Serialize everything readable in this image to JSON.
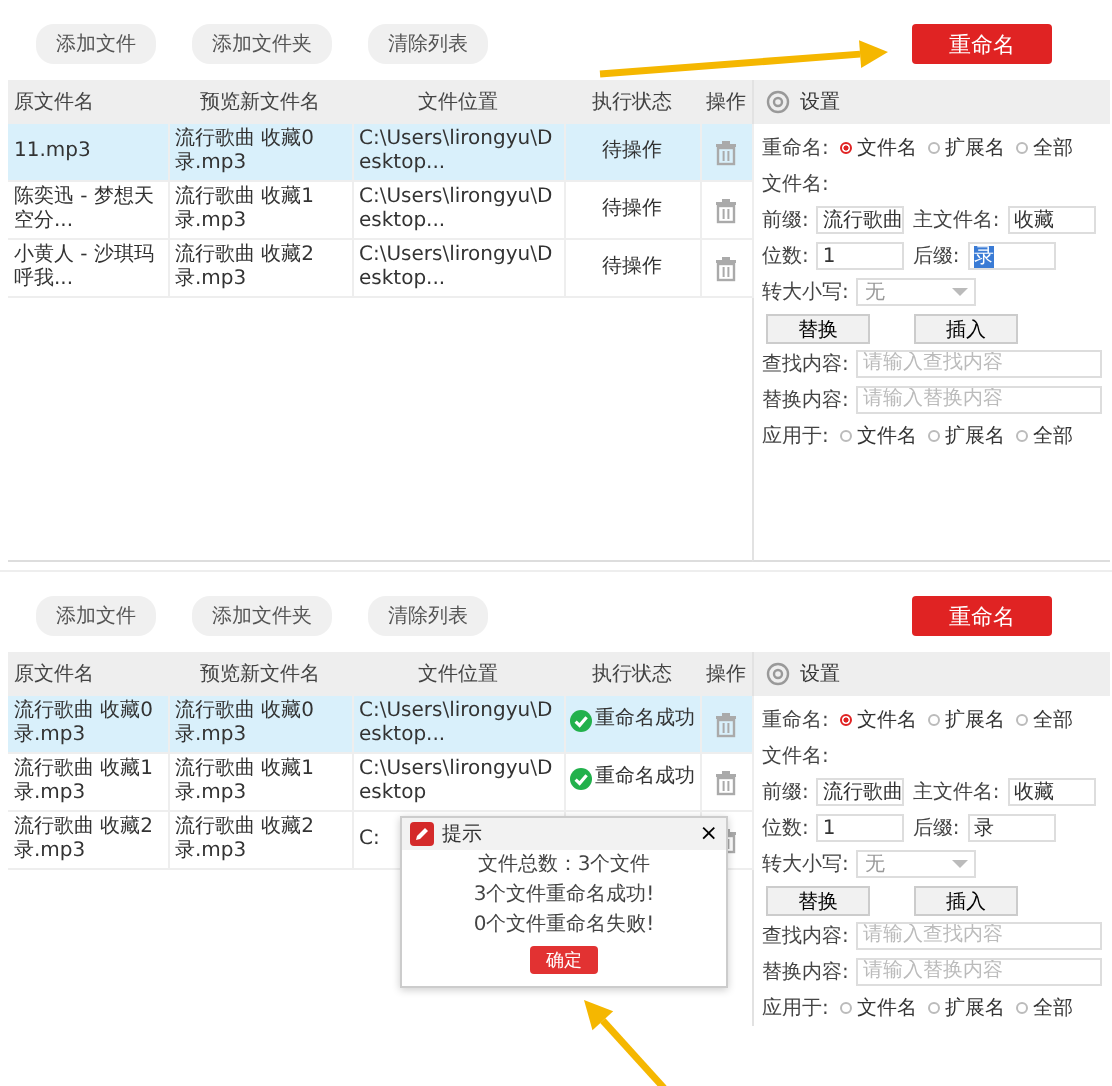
{
  "panels": [
    {
      "arrow": {
        "kind": "rename"
      },
      "toolbar": {
        "buttons": [
          "添加文件",
          "添加文件夹",
          "清除列表"
        ],
        "rename_button": "重命名"
      },
      "table": {
        "columns": [
          "原文件名",
          "预览新文件名",
          "文件位置",
          "执行状态",
          "操作"
        ],
        "rows": [
          {
            "selected": true,
            "original": "11.mp3",
            "preview": "流行歌曲 收藏0录.mp3",
            "location": "C:\\Users\\lirongyu\\Desktop...",
            "status": "待操作",
            "kind": "pending"
          },
          {
            "selected": false,
            "original": "陈奕迅 - 梦想天空分...",
            "preview": "流行歌曲 收藏1录.mp3",
            "location": "C:\\Users\\lirongyu\\Desktop...",
            "status": "待操作",
            "kind": "pending"
          },
          {
            "selected": false,
            "original": "小黄人 - 沙琪玛呼我...",
            "preview": "流行歌曲 收藏2录.mp3",
            "location": "C:\\Users\\lirongyu\\Desktop...",
            "status": "待操作",
            "kind": "pending"
          }
        ]
      },
      "settings": {
        "title": "设置",
        "rename_label": "重命名:",
        "rename_options": [
          {
            "label": "文件名",
            "selected": true
          },
          {
            "label": "扩展名",
            "selected": false
          },
          {
            "label": "全部",
            "selected": false
          }
        ],
        "filename_label": "文件名:",
        "prefix_label": "前缀:",
        "prefix": "流行歌曲",
        "main_label": "主文件名:",
        "main": "收藏",
        "digits_label": "位数:",
        "digits": "1",
        "suffix_label": "后缀:",
        "suffix": "录",
        "suffix_highlighted": true,
        "case_label": "转大小写:",
        "case_value": "无",
        "replace_button": "替换",
        "insert_button": "插入",
        "find_label": "查找内容:",
        "find_placeholder": "请输入查找内容",
        "replace_label": "替换内容:",
        "replace_placeholder": "请输入替换内容",
        "apply_label": "应用于:",
        "apply_options": [
          {
            "label": "文件名",
            "selected": false
          },
          {
            "label": "扩展名",
            "selected": false
          },
          {
            "label": "全部",
            "selected": false
          }
        ]
      }
    },
    {
      "arrow": {
        "kind": "confirm"
      },
      "toolbar": {
        "buttons": [
          "添加文件",
          "添加文件夹",
          "清除列表"
        ],
        "rename_button": "重命名"
      },
      "table": {
        "columns": [
          "原文件名",
          "预览新文件名",
          "文件位置",
          "执行状态",
          "操作"
        ],
        "rows": [
          {
            "selected": true,
            "original": "流行歌曲 收藏0录.mp3",
            "preview": "流行歌曲 收藏0录.mp3",
            "location": "C:\\Users\\lirongyu\\Desktop...",
            "status": "重命名成功",
            "kind": "success"
          },
          {
            "selected": false,
            "original": "流行歌曲 收藏1录.mp3",
            "preview": "流行歌曲 收藏1录.mp3",
            "location": "C:\\Users\\lirongyu\\Desktop",
            "status": "重命名成功",
            "kind": "success"
          },
          {
            "selected": false,
            "original": "流行歌曲 收藏2录.mp3",
            "preview": "流行歌曲 收藏2录.mp3",
            "location": "C:"
          }
        ]
      },
      "settings": {
        "title": "设置",
        "rename_label": "重命名:",
        "rename_options": [
          {
            "label": "文件名",
            "selected": true
          },
          {
            "label": "扩展名",
            "selected": false
          },
          {
            "label": "全部",
            "selected": false
          }
        ],
        "filename_label": "文件名:",
        "prefix_label": "前缀:",
        "prefix": "流行歌曲",
        "main_label": "主文件名:",
        "main": "收藏",
        "digits_label": "位数:",
        "digits": "1",
        "suffix_label": "后缀:",
        "suffix": "录",
        "suffix_highlighted": false,
        "case_label": "转大小写:",
        "case_value": "无",
        "replace_button": "替换",
        "insert_button": "插入",
        "find_label": "查找内容:",
        "find_placeholder": "请输入查找内容",
        "replace_label": "替换内容:",
        "replace_placeholder": "请输入替换内容",
        "apply_label": "应用于:",
        "apply_options": [
          {
            "label": "文件名",
            "selected": false
          },
          {
            "label": "扩展名",
            "selected": false
          },
          {
            "label": "全部",
            "selected": false
          }
        ]
      },
      "dialog": {
        "title": "提示",
        "close": "×",
        "lines": [
          "文件总数：3个文件",
          "3个文件重命名成功!",
          "0个文件重命名失败!"
        ],
        "button": "确定"
      }
    }
  ]
}
